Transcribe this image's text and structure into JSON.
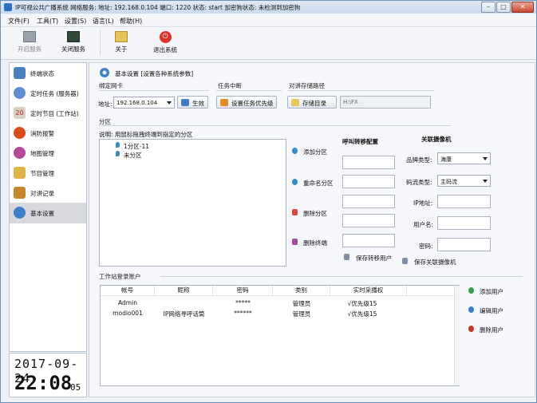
{
  "window": {
    "title": "IP可视公共广播系统 网络服务: 地址: 192.168.0.104 端口: 1220 状态: start   加密狗状态: 未检测到加密狗",
    "controls": {
      "minimize": "–",
      "maximize": "□",
      "close": "✕"
    }
  },
  "menu": [
    {
      "label": "文件(F)"
    },
    {
      "label": "工具(T)"
    },
    {
      "label": "设置(S)"
    },
    {
      "label": "语言(L)"
    },
    {
      "label": "帮助(H)"
    }
  ],
  "toolbar": [
    {
      "label": "开启服务",
      "icon": "monitor-icon",
      "enabled": false
    },
    {
      "label": "关闭服务",
      "icon": "server-stop-icon",
      "enabled": true
    },
    {
      "label": "关于",
      "icon": "folder-icon",
      "enabled": true
    },
    {
      "label": "退出系统",
      "icon": "power-icon",
      "enabled": true
    }
  ],
  "sidebar": [
    {
      "label": "终端状态",
      "icon": "terminal-icon",
      "color": "#4a7fc0"
    },
    {
      "label": "定时任务 (服务器)",
      "icon": "clock-icon",
      "color": "#5b8fd1"
    },
    {
      "label": "定时节目 (工作站)",
      "icon": "calendar-icon",
      "color": "#d9d0c2"
    },
    {
      "label": "消防报警",
      "icon": "fire-icon",
      "color": "#d94a1c"
    },
    {
      "label": "地图管理",
      "icon": "map-icon",
      "color": "#b04a9a"
    },
    {
      "label": "节目管理",
      "icon": "edit-icon",
      "color": "#e0b447"
    },
    {
      "label": "对讲记录",
      "icon": "book-icon",
      "color": "#c9862d"
    },
    {
      "label": "基本设置",
      "icon": "gear-icon",
      "color": "#3f7fc9",
      "selected": true
    }
  ],
  "clock": {
    "date": "2017-09-24",
    "time": "22:08",
    "seconds": "05"
  },
  "page": {
    "title": "基本设置 [设置各种系统参数]",
    "bind_nic": {
      "group_label": "绑定网卡",
      "address_label": "地址:",
      "address_value": "192.168.0.104",
      "apply_button": "生效"
    },
    "task_interrupt": {
      "group_label": "任务中断",
      "button": "设置任务优先级"
    },
    "intercom_path": {
      "group_label": "对讲存储路径",
      "button": "存储目录",
      "path": "H:\\FX"
    },
    "zones": {
      "group_label": "分区",
      "hint": "说明: 用鼠标拖拽终端到指定的分区",
      "tree": [
        "1分区-11",
        "未分区"
      ],
      "actions": [
        "添加分区",
        "重命名分区",
        "删除分区",
        "删除终端"
      ]
    },
    "call_forward": {
      "label": "呼叫转移配置",
      "save": "保存转移用户"
    },
    "camera": {
      "label": "关联摄像机",
      "brand_label": "品牌类型:",
      "brand_value": "海康",
      "stream_label": "码流类型:",
      "stream_value": "主码流",
      "ip_label": "IP地址:",
      "user_label": "用户名:",
      "password_label": "密码:",
      "save": "保存关联摄像机"
    },
    "accounts": {
      "group_label": "工作站登录账户",
      "columns": [
        "帐号",
        "昵称",
        "密码",
        "类别",
        "实时采播权"
      ],
      "rows": [
        [
          "Admin",
          "",
          "*****",
          "管理员",
          "√优先级15"
        ],
        [
          "modio001",
          "IP网络寻呼话筒",
          "******",
          "管理员",
          "√优先级15"
        ]
      ],
      "actions": [
        "添加用户",
        "编辑用户",
        "删除用户"
      ]
    }
  }
}
